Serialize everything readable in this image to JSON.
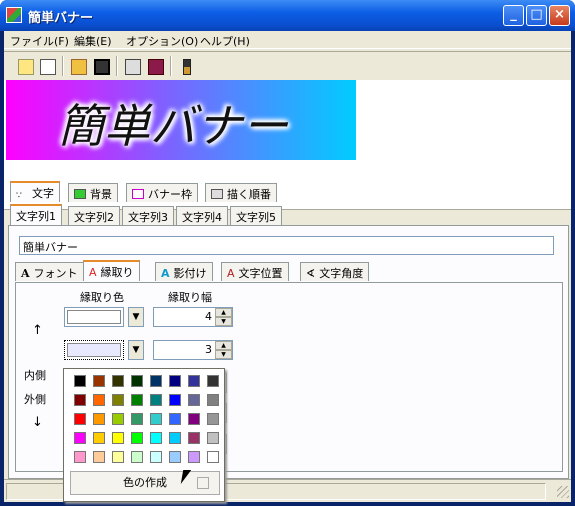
{
  "window": {
    "title": "簡単バナー"
  },
  "menu": [
    "ファイル(F)",
    "編集(E)",
    "オプション(O)",
    "ヘルプ(H)"
  ],
  "toolbar_icons": [
    "new-icon",
    "copy-icon",
    "open-icon",
    "save-icon",
    "properties-icon",
    "book-icon",
    "brush-icon"
  ],
  "banner": {
    "text": "簡単バナー"
  },
  "main_tabs": [
    {
      "label": "文字",
      "icon": "text-icon"
    },
    {
      "label": "背景",
      "icon": "background-icon"
    },
    {
      "label": "バナー枠",
      "icon": "frame-icon"
    },
    {
      "label": "描く順番",
      "icon": "order-icon"
    }
  ],
  "string_tabs": [
    "文字列1",
    "文字列2",
    "文字列3",
    "文字列4",
    "文字列5"
  ],
  "text_value": "簡単バナー",
  "sub_tabs": [
    {
      "label": "フォント",
      "icon": "font-icon"
    },
    {
      "label": "縁取り",
      "icon": "outline-icon"
    },
    {
      "label": "影付け",
      "icon": "shadow-icon"
    },
    {
      "label": "文字位置",
      "icon": "position-icon"
    },
    {
      "label": "文字角度",
      "icon": "angle-icon"
    }
  ],
  "outline": {
    "color_header": "縁取り色",
    "width_header": "縁取り幅",
    "row1_width": "4",
    "row2_width": "3",
    "up_arrow": "↑",
    "down_arrow": "↓",
    "inner": "内側",
    "outer": "外側"
  },
  "palette": {
    "make_color": "色の作成",
    "colors": [
      "#000000",
      "#993300",
      "#333300",
      "#003300",
      "#003366",
      "#000080",
      "#333399",
      "#333333",
      "#800000",
      "#ff6600",
      "#808000",
      "#008000",
      "#008080",
      "#0000ff",
      "#666699",
      "#808080",
      "#ff0000",
      "#ff9900",
      "#99cc00",
      "#339966",
      "#33cccc",
      "#3366ff",
      "#800080",
      "#969696",
      "#ff00ff",
      "#ffcc00",
      "#ffff00",
      "#00ff00",
      "#00ffff",
      "#00ccff",
      "#993366",
      "#c0c0c0",
      "#ff99cc",
      "#ffcc99",
      "#ffff99",
      "#ccffcc",
      "#ccffff",
      "#99ccff",
      "#cc99ff",
      "#ffffff"
    ]
  }
}
